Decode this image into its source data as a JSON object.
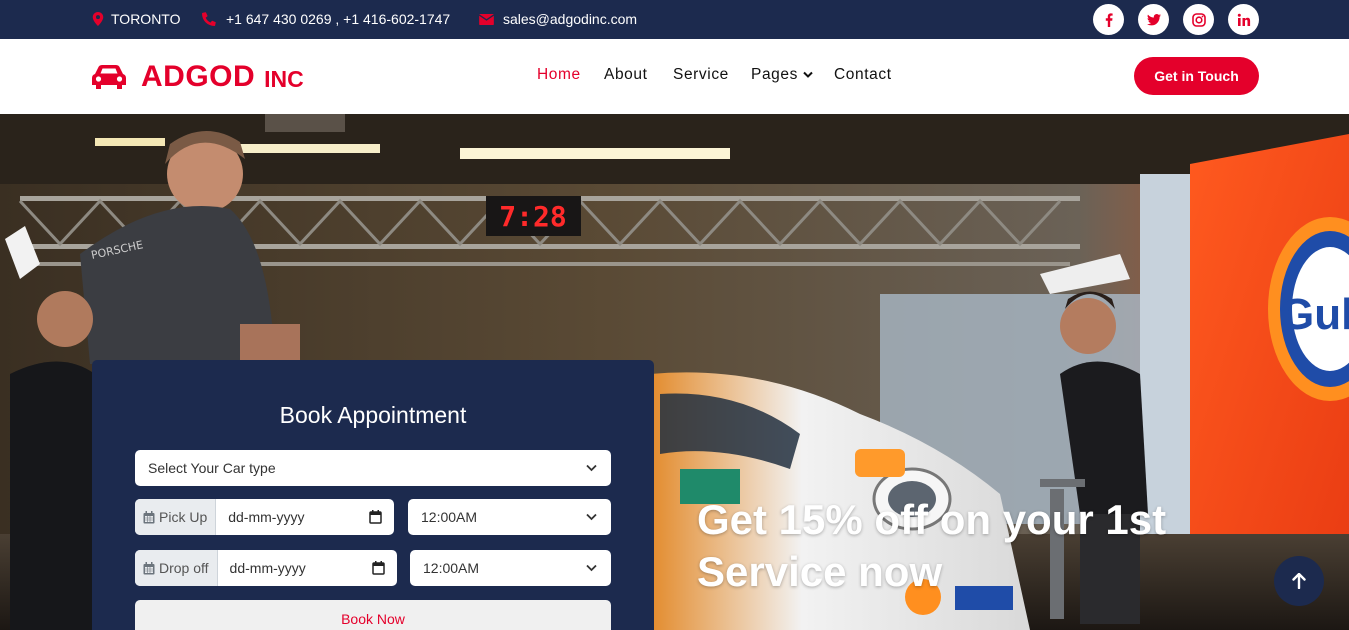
{
  "topbar": {
    "location": "TORONTO",
    "phone": "+1 647 430 0269 , +1 416-602-1747",
    "email": "sales@adgodinc.com",
    "social": [
      {
        "name": "facebook-icon",
        "glyph": "f"
      },
      {
        "name": "twitter-icon",
        "glyph": "t"
      },
      {
        "name": "instagram-icon",
        "glyph": "i"
      },
      {
        "name": "linkedin-icon",
        "glyph": "in"
      }
    ]
  },
  "brand": {
    "name": "ADGOD",
    "suffix": "INC",
    "icon": "car-icon",
    "color": "#e4002b"
  },
  "nav": {
    "home": "Home",
    "about": "About",
    "service": "Service",
    "pages": "Pages",
    "contact": "Contact",
    "cta": "Get in Touch",
    "active": "Home"
  },
  "hero": {
    "promo_line1": "Get 15% off on your 1st",
    "promo_line2": "Service now",
    "clock_text": "7:28"
  },
  "booking": {
    "title": "Book Appointment",
    "car_type_placeholder": "Select Your Car type",
    "pickup_label": "Pick Up",
    "pickup_date_placeholder": "dd-mm-yyyy",
    "pickup_time": "12:00AM",
    "dropoff_label": "Drop off",
    "dropoff_date_placeholder": "dd-mm-yyyy",
    "dropoff_time": "12:00AM",
    "submit": "Book Now"
  },
  "colors": {
    "navy": "#1c2a4e",
    "accent": "#e4002b"
  }
}
